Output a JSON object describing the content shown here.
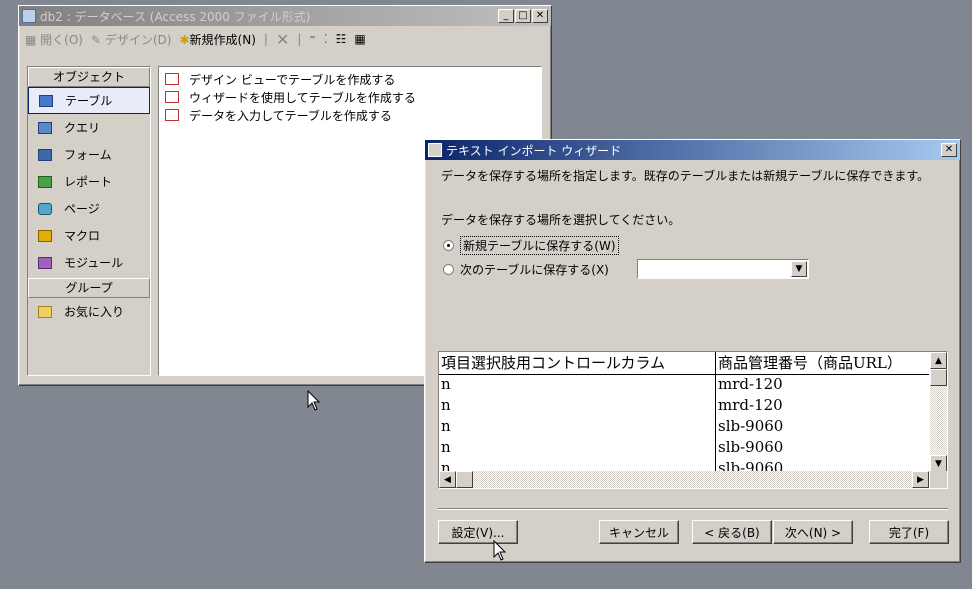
{
  "db_window": {
    "title": "db2 : データベース (Access 2000 ファイル形式)",
    "toolbar": {
      "open": "開く(O)",
      "design": "デザイン(D)",
      "new": "新規作成(N)"
    },
    "objects_header": "オブジェクト",
    "objects": [
      "テーブル",
      "クエリ",
      "フォーム",
      "レポート",
      "ページ",
      "マクロ",
      "モジュール"
    ],
    "groups_header": "グループ",
    "favorites": "お気に入り",
    "items": [
      "デザイン ビューでテーブルを作成する",
      "ウィザードを使用してテーブルを作成する",
      "データを入力してテーブルを作成する"
    ]
  },
  "wizard": {
    "title": "テキスト インポート ウィザード",
    "description": "データを保存する場所を指定します。既存のテーブルまたは新規テーブルに保存できます。",
    "prompt": "データを保存する場所を選択してください。",
    "option_new": "新規テーブルに保存する(W)",
    "option_existing": "次のテーブルに保存する(X)",
    "existing_value": "",
    "preview": {
      "headers": [
        "項目選択肢用コントロールカラム",
        "商品管理番号（商品URL）"
      ],
      "rows": [
        [
          "n",
          "mrd-120"
        ],
        [
          "n",
          "mrd-120"
        ],
        [
          "n",
          "slb-9060"
        ],
        [
          "n",
          "slb-9060"
        ],
        [
          "n",
          "slb-9060"
        ]
      ]
    },
    "buttons": {
      "settings": "設定(V)...",
      "cancel": "キャンセル",
      "back": "< 戻る(B)",
      "next": "次へ(N) >",
      "finish": "完了(F)"
    }
  }
}
